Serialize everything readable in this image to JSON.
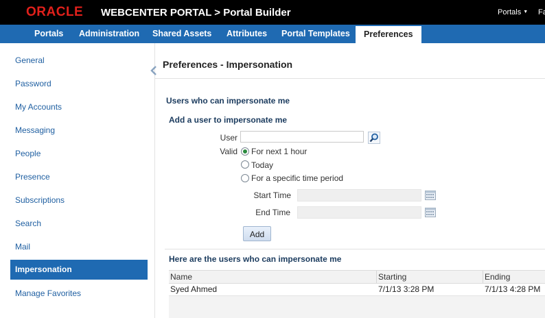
{
  "header": {
    "logo": "ORACLE",
    "title": "WEBCENTER PORTAL > Portal Builder",
    "portals_menu": "Portals",
    "cut_item": "Fa"
  },
  "nav": {
    "tabs": [
      "Portals",
      "Administration",
      "Shared Assets",
      "Attributes",
      "Portal Templates",
      "Preferences"
    ],
    "active": "Preferences"
  },
  "sidebar": {
    "items": [
      "General",
      "Password",
      "My Accounts",
      "Messaging",
      "People",
      "Presence",
      "Subscriptions",
      "Search",
      "Mail",
      "Impersonation",
      "Manage Favorites"
    ],
    "active": "Impersonation"
  },
  "page": {
    "title": "Preferences - Impersonation",
    "section_title": "Users who can impersonate me",
    "add_title": "Add a user to impersonate me"
  },
  "form": {
    "user_label": "User",
    "user_value": "",
    "valid_label": "Valid",
    "options": [
      "For next 1 hour",
      "Today",
      "For a specific time period"
    ],
    "selected_option": "For next 1 hour",
    "start_label": "Start Time",
    "end_label": "End Time",
    "add_button": "Add"
  },
  "table": {
    "title": "Here are the users who can impersonate me",
    "columns": [
      "Name",
      "Starting",
      "Ending"
    ],
    "rows": [
      [
        "Syed Ahmed",
        "7/1/13 3:28 PM",
        "7/1/13 4:28 PM"
      ]
    ]
  },
  "icons": {
    "search": "search-icon",
    "calendar": "calendar-icon",
    "collapse": "chevron-left-icon"
  }
}
